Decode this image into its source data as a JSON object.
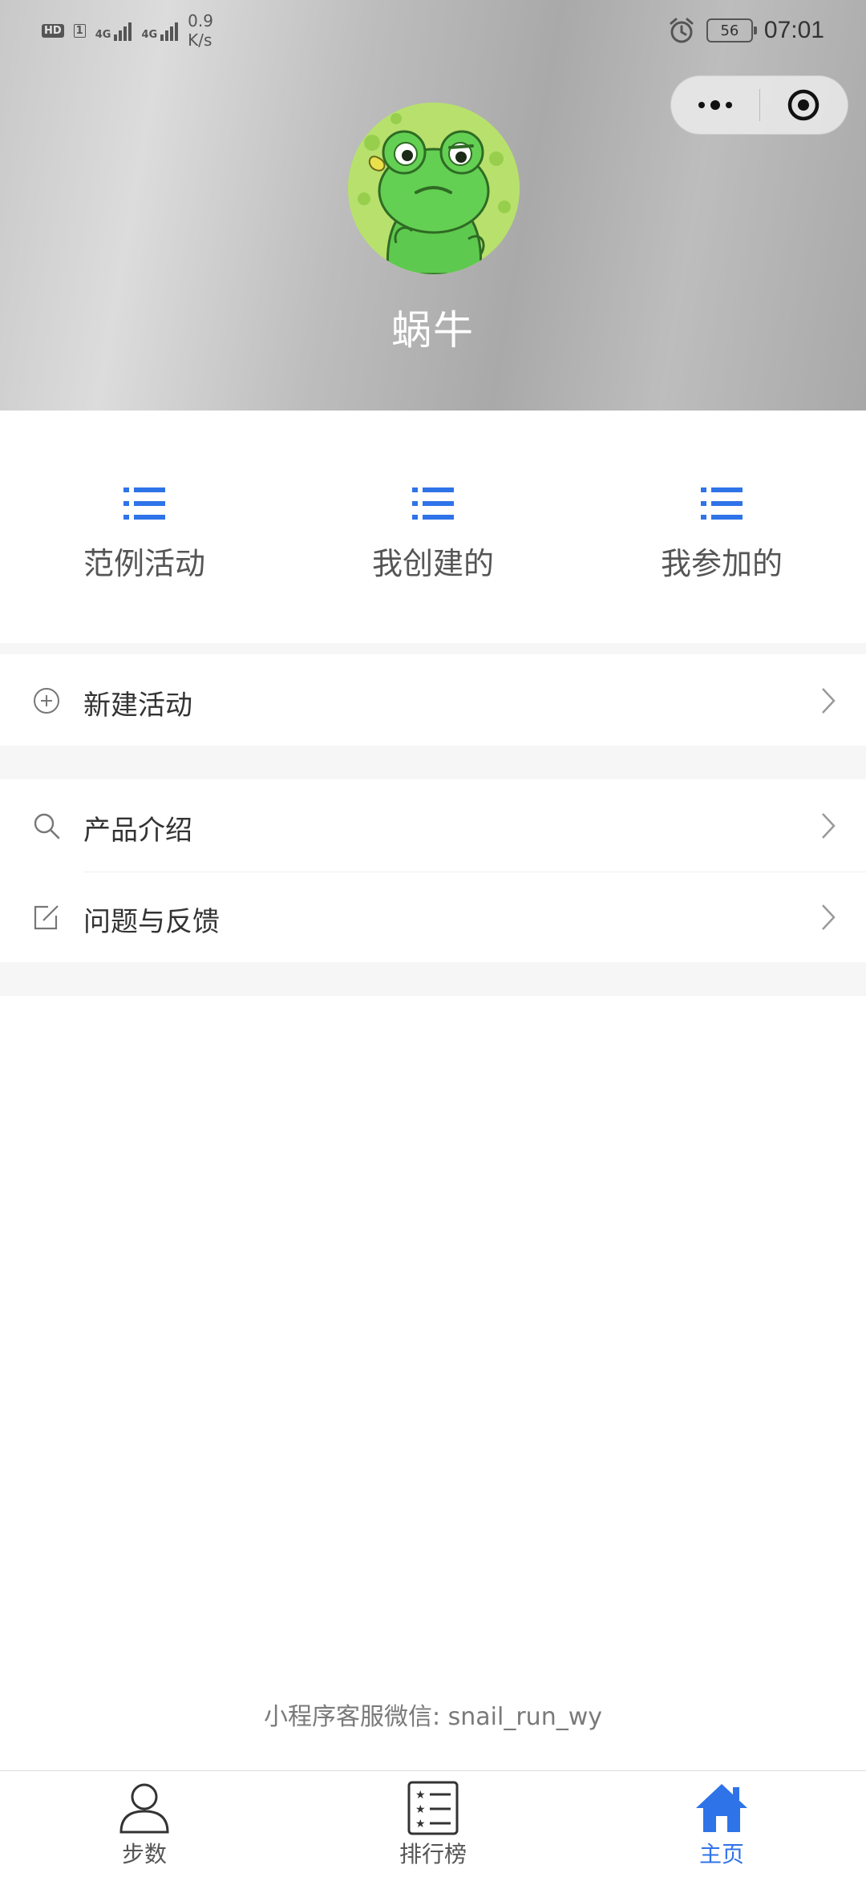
{
  "status_bar": {
    "hd": "HD",
    "sim": "1",
    "net1": "4G",
    "net2": "4G",
    "speed_value": "0.9",
    "speed_unit": "K/s",
    "battery": "56",
    "time": "07:01"
  },
  "profile": {
    "name": "蜗牛"
  },
  "shortcuts": [
    {
      "label": "范例活动",
      "icon": "list-icon"
    },
    {
      "label": "我创建的",
      "icon": "list-icon"
    },
    {
      "label": "我参加的",
      "icon": "list-icon"
    }
  ],
  "menu": {
    "new_activity": "新建活动",
    "product_intro": "产品介绍",
    "feedback": "问题与反馈"
  },
  "footer": {
    "contact": "小程序客服微信: snail_run_wy"
  },
  "tabbar": {
    "steps": "步数",
    "ranking": "排行榜",
    "home": "主页"
  },
  "colors": {
    "accent": "#2f73e8",
    "text": "#333333",
    "muted": "#7a7a7a"
  }
}
